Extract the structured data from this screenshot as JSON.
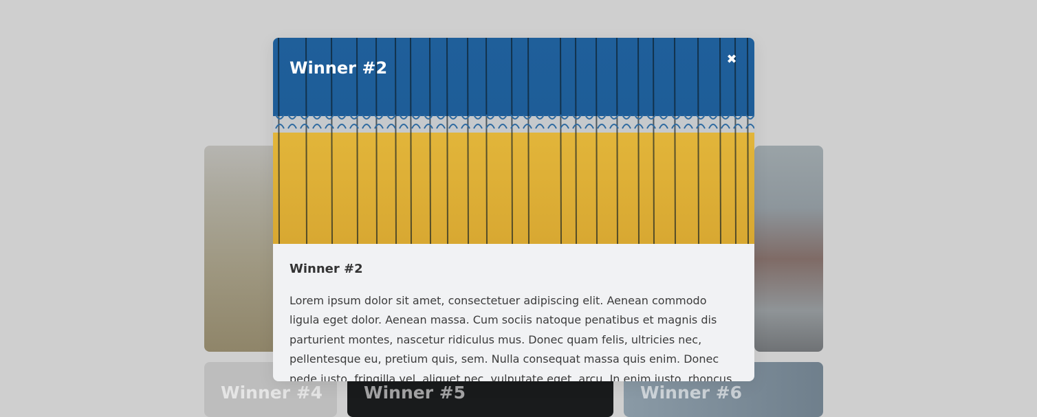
{
  "modal": {
    "hero_title": "Winner #2",
    "close_icon": "✖",
    "heading": "Winner #2",
    "body": "Lorem ipsum dolor sit amet, consectetuer adipiscing elit. Aenean commodo ligula eget dolor. Aenean massa. Cum sociis natoque penatibus et magnis dis parturient montes, nascetur ridiculus mus. Donec quam felis, ultricies nec, pellentesque eu, pretium quis, sem. Nulla consequat massa quis enim. Donec pede justo, fringilla vel, aliquet nec, vulputate eget, arcu. In enim justo, rhoncus ut, imperdiet a"
  },
  "gallery": {
    "card4_title": "Winner #4",
    "card5_title": "Winner #5",
    "card6_title": "Winner #6"
  }
}
